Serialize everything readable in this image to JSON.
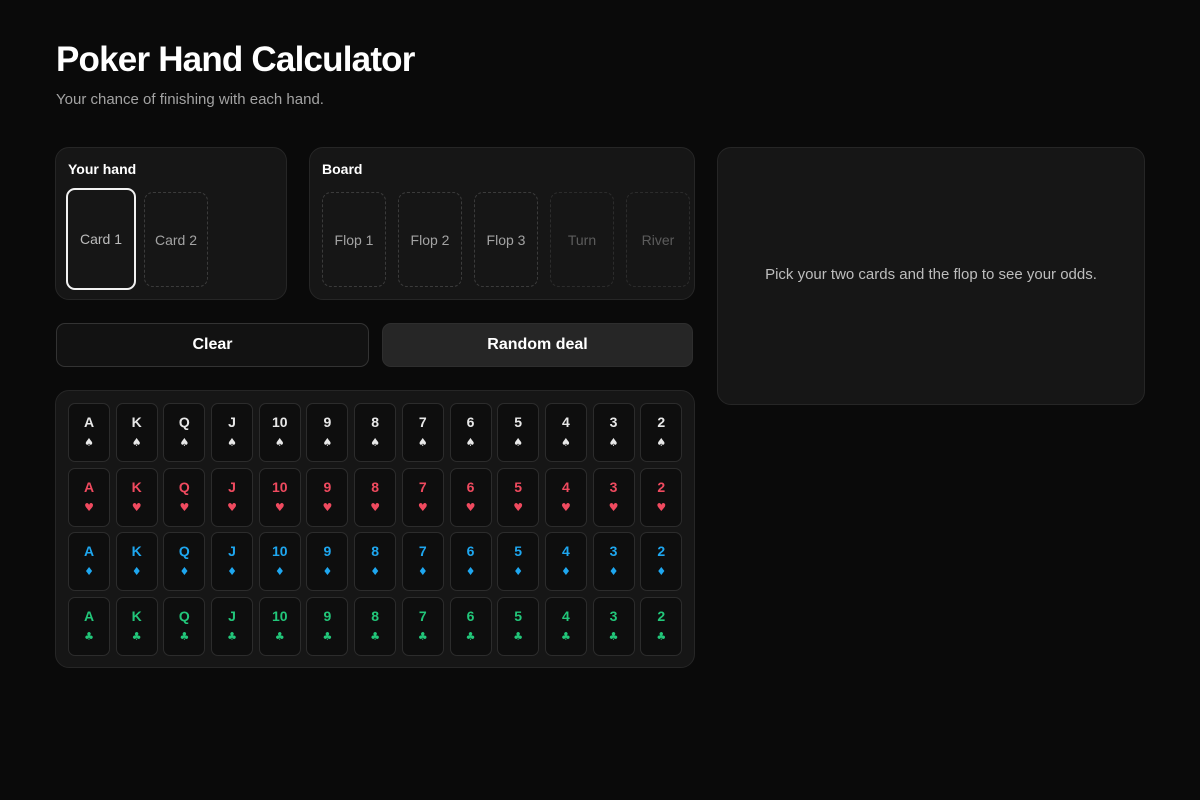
{
  "page": {
    "title": "Poker Hand Calculator",
    "subtitle": "Your chance of finishing with each hand."
  },
  "hand": {
    "label": "Your hand",
    "slots": [
      "Card 1",
      "Card 2"
    ],
    "active_slot": "Card 1"
  },
  "board": {
    "label": "Board",
    "slots": [
      "Flop 1",
      "Flop 2",
      "Flop 3",
      "Turn",
      "River"
    ],
    "disabled_slots": [
      "Turn",
      "River"
    ]
  },
  "buttons": {
    "clear": "Clear",
    "random_deal": "Random deal"
  },
  "deck": {
    "ranks": [
      "A",
      "K",
      "Q",
      "J",
      "10",
      "9",
      "8",
      "7",
      "6",
      "5",
      "4",
      "3",
      "2"
    ],
    "suits": [
      {
        "name": "spades",
        "symbol": "♠",
        "color": "#e8e8e8"
      },
      {
        "name": "hearts",
        "symbol": "♥",
        "color": "#f04a5f"
      },
      {
        "name": "diamonds",
        "symbol": "♦",
        "color": "#1ea7f0"
      },
      {
        "name": "clubs",
        "symbol": "♣",
        "color": "#22c77a"
      }
    ]
  },
  "odds": {
    "message": "Pick your two cards and the flop to see your odds."
  }
}
